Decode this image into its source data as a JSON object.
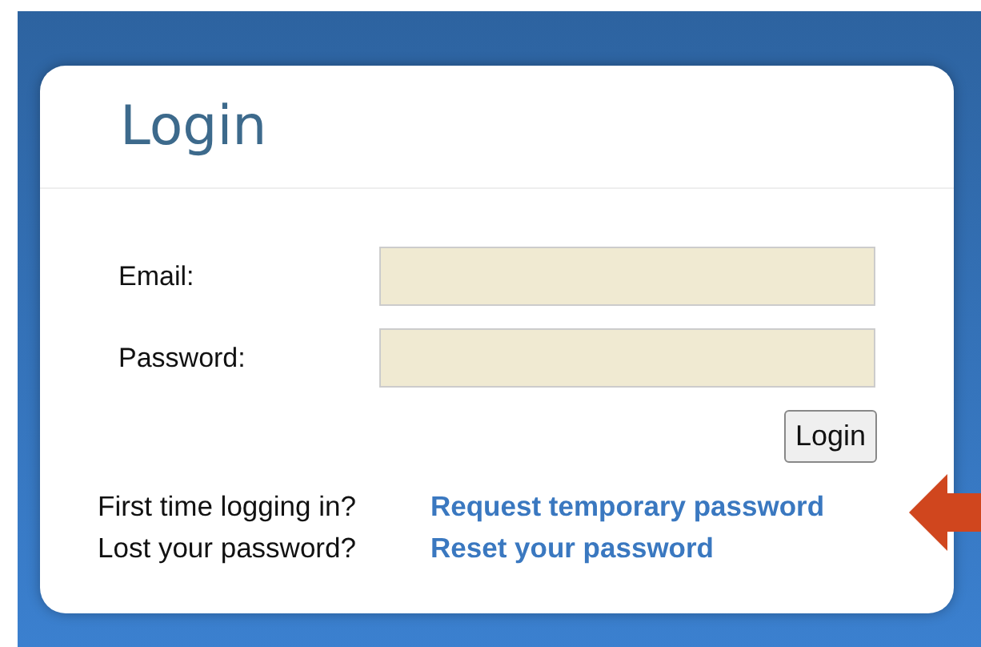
{
  "title": "Login",
  "fields": [
    {
      "label": "Email:"
    },
    {
      "label": "Password:"
    }
  ],
  "submit": "Login",
  "links": [
    {
      "prompt": "First time logging in?",
      "link": "Request temporary password"
    },
    {
      "prompt": "Lost your password?",
      "link": "Reset your password"
    }
  ]
}
